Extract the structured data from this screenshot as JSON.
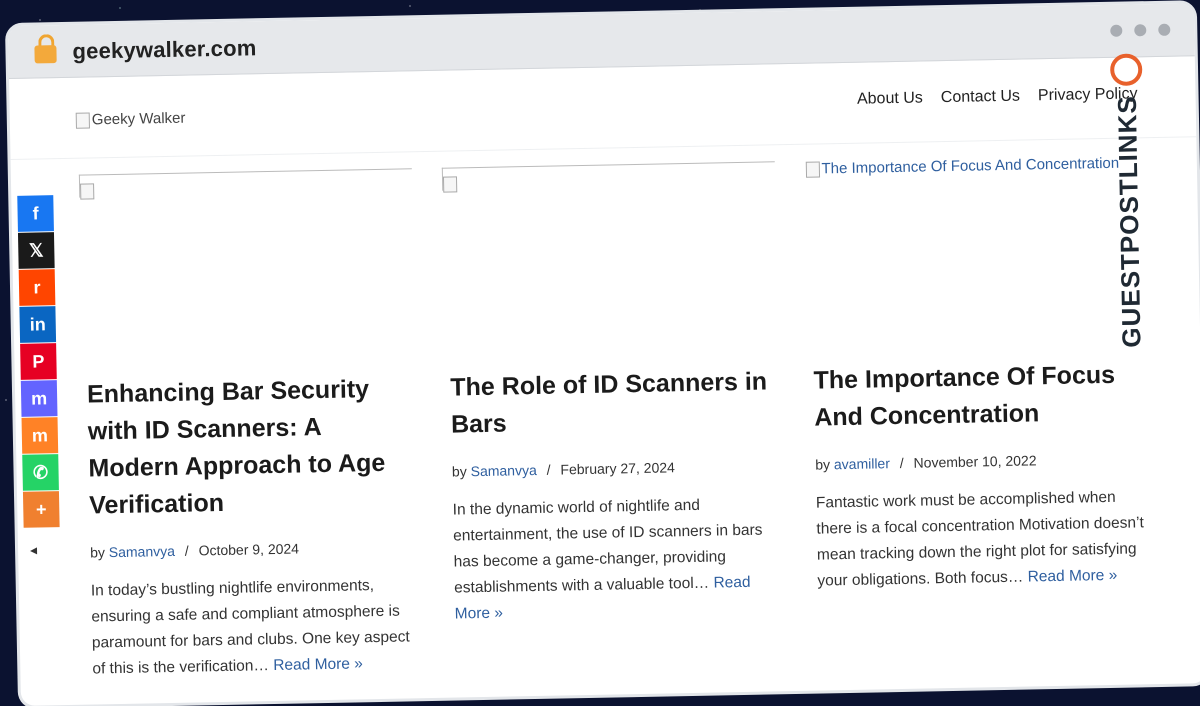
{
  "browser": {
    "url": "geekywalker.com"
  },
  "site": {
    "logo_alt": "Geeky Walker",
    "nav": [
      "About Us",
      "Contact Us",
      "Privacy Policy"
    ]
  },
  "brand_label": "GUESTPOSTLINKS",
  "share_buttons": [
    {
      "name": "facebook",
      "glyph": "f",
      "color": "#1877f2"
    },
    {
      "name": "x",
      "glyph": "𝕏",
      "color": "#1a1a1a"
    },
    {
      "name": "reddit",
      "glyph": "r",
      "color": "#ff4500"
    },
    {
      "name": "linkedin",
      "glyph": "in",
      "color": "#0a66c2"
    },
    {
      "name": "pinterest",
      "glyph": "P",
      "color": "#e60023"
    },
    {
      "name": "mastodon",
      "glyph": "m",
      "color": "#6364ff"
    },
    {
      "name": "mix",
      "glyph": "m",
      "color": "#ff8226"
    },
    {
      "name": "whatsapp",
      "glyph": "✆",
      "color": "#25d366"
    },
    {
      "name": "more",
      "glyph": "+",
      "color": "#f0802f"
    }
  ],
  "posts": [
    {
      "image_alt": "",
      "title": "Enhancing Bar Security with ID Scanners: A Modern Approach to Age Verification",
      "by": "by",
      "author": "Samanvya",
      "date": "October 9, 2024",
      "excerpt": "In today’s bustling nightlife environments, ensuring a safe and compliant atmosphere is paramount for bars and clubs. One key aspect of this is the verification…",
      "read_more": "Read More »"
    },
    {
      "image_alt": "",
      "title": "The Role of ID Scanners in Bars",
      "by": "by",
      "author": "Samanvya",
      "date": "February 27, 2024",
      "excerpt": "In the dynamic world of nightlife and entertainment, the use of ID scanners in bars has become a game-changer, providing establishments with a valuable tool…",
      "read_more": "Read More »"
    },
    {
      "image_alt": "The Importance Of Focus And Concentration",
      "title": "The Importance Of Focus And Concentration",
      "by": "by",
      "author": "avamiller",
      "date": "November 10, 2022",
      "excerpt": "Fantastic work must be accomplished when there is a focal concentration Motivation doesn’t mean tracking down the right plot for satisfying your obligations. Both focus…",
      "read_more": "Read More »"
    }
  ]
}
